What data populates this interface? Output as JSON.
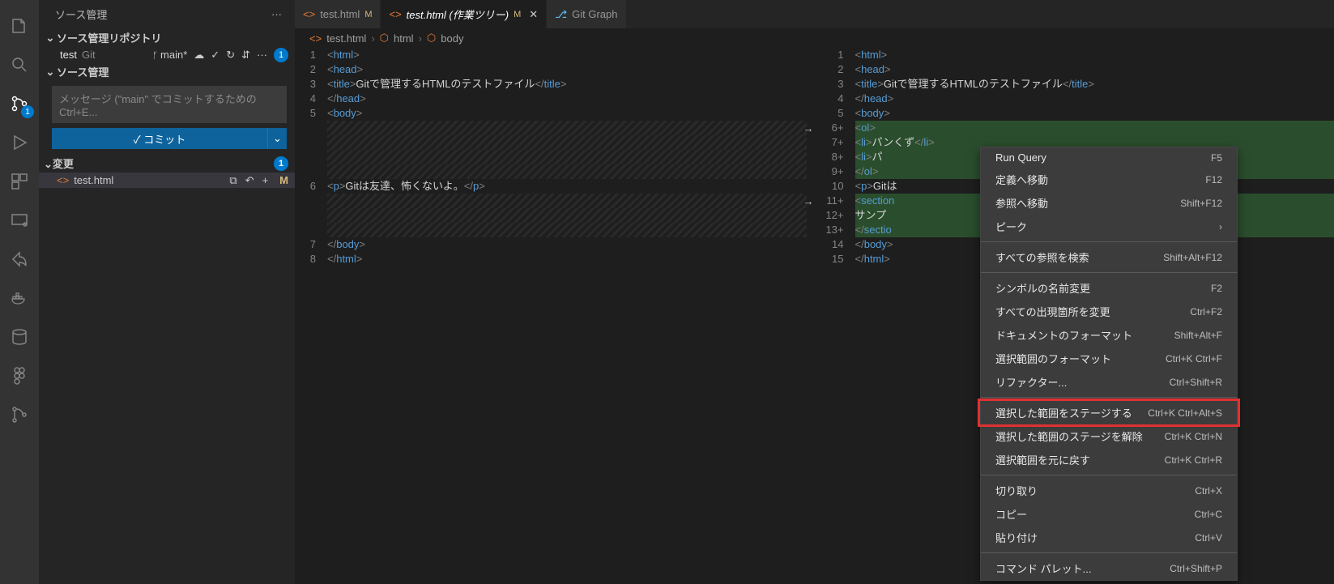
{
  "sidebar_title": "ソース管理",
  "sections": {
    "repo": "ソース管理リポジトリ",
    "scm": "ソース管理",
    "changes": "変更"
  },
  "repo": {
    "name": "test",
    "type": "Git",
    "branch": "main*",
    "badge": "1"
  },
  "commit": {
    "placeholder": "メッセージ (\"main\" でコミットするためのCtrl+E...",
    "button": "✓ コミット"
  },
  "changes_badge": "1",
  "file": {
    "name": "test.html",
    "status": "M"
  },
  "tabs": [
    {
      "icon": "<>",
      "label": "test.html",
      "mod": "M"
    },
    {
      "icon": "<>",
      "label": "test.html (作業ツリー)",
      "mod": "M",
      "active": true,
      "close": true,
      "italic": true
    },
    {
      "icon": "gg",
      "label": "Git Graph"
    }
  ],
  "breadcrumb": [
    "test.html",
    "html",
    "body"
  ],
  "left_lines": [
    {
      "n": "1",
      "html": "<span class='tag'>&lt;</span><span class='name'>html</span><span class='tag'>&gt;</span>"
    },
    {
      "n": "2",
      "html": "  <span class='tag'>&lt;</span><span class='name'>head</span><span class='tag'>&gt;</span>"
    },
    {
      "n": "3",
      "html": "    <span class='tag'>&lt;</span><span class='name'>title</span><span class='tag'>&gt;</span><span class='txt'>Gitで管理するHTMLのテストファイル</span><span class='tag'>&lt;/</span><span class='name'>title</span><span class='tag'>&gt;</span>"
    },
    {
      "n": "4",
      "html": "  <span class='tag'>&lt;/</span><span class='name'>head</span><span class='tag'>&gt;</span>"
    },
    {
      "n": "5",
      "html": "  <span class='tag'>&lt;</span><span class='name'>body</span><span class='tag'>&gt;</span>"
    },
    {
      "n": "",
      "html": "",
      "cls": "hatch"
    },
    {
      "n": "",
      "html": "",
      "cls": "hatch"
    },
    {
      "n": "",
      "html": "",
      "cls": "hatch"
    },
    {
      "n": "",
      "html": "",
      "cls": "hatch"
    },
    {
      "n": "6",
      "html": "    <span class='tag'>&lt;</span><span class='name'>p</span><span class='tag'>&gt;</span><span class='txt'>Gitは友達、怖くないよ。</span><span class='tag'>&lt;/</span><span class='name'>p</span><span class='tag'>&gt;</span>"
    },
    {
      "n": "",
      "html": "",
      "cls": "hatch"
    },
    {
      "n": "",
      "html": "",
      "cls": "hatch"
    },
    {
      "n": "",
      "html": "",
      "cls": "hatch"
    },
    {
      "n": "7",
      "html": "  <span class='tag'>&lt;/</span><span class='name'>body</span><span class='tag'>&gt;</span>"
    },
    {
      "n": "8",
      "html": "<span class='tag'>&lt;/</span><span class='name'>html</span><span class='tag'>&gt;</span>"
    }
  ],
  "right_lines": [
    {
      "n": "1",
      "html": "<span class='tag'>&lt;</span><span class='name'>html</span><span class='tag'>&gt;</span>"
    },
    {
      "n": "2",
      "html": "  <span class='tag'>&lt;</span><span class='name'>head</span><span class='tag'>&gt;</span>"
    },
    {
      "n": "3",
      "html": "    <span class='tag'>&lt;</span><span class='name'>title</span><span class='tag'>&gt;</span><span class='txt'>Gitで管理するHTMLのテストファイル</span><span class='tag'>&lt;/</span><span class='name'>title</span><span class='tag'>&gt;</span>"
    },
    {
      "n": "4",
      "html": "  <span class='tag'>&lt;/</span><span class='name'>head</span><span class='tag'>&gt;</span>"
    },
    {
      "n": "5",
      "html": "  <span class='tag'>&lt;</span><span class='name'>body</span><span class='tag'>&gt;</span>"
    },
    {
      "n": "6+",
      "html": "    <span class='tag'>&lt;</span><span class='name'>ol</span><span class='tag'>&gt;</span>",
      "cls": "added"
    },
    {
      "n": "7+",
      "html": "      <span class='tag'>&lt;</span><span class='name'>li</span><span class='tag'>&gt;</span><span class='txt'>パンくず</span><span class='tag'>&lt;/</span><span class='name'>li</span><span class='tag'>&gt;</span>",
      "cls": "added"
    },
    {
      "n": "8+",
      "html": "      <span class='tag'>&lt;</span><span class='name'>li</span><span class='tag'>&gt;</span><span class='txt'>パ</span>",
      "cls": "added"
    },
    {
      "n": "9+",
      "html": "    <span class='tag'>&lt;/</span><span class='name'>ol</span><span class='tag'>&gt;</span>",
      "cls": "added"
    },
    {
      "n": "10",
      "html": "    <span class='tag'>&lt;</span><span class='name'>p</span><span class='tag'>&gt;</span><span class='txt'>Gitは</span>"
    },
    {
      "n": "11+",
      "html": "    <span class='tag'>&lt;</span><span class='name'>section</span>",
      "cls": "added"
    },
    {
      "n": "12+",
      "html": "      <span class='txt'>サンプ</span>",
      "cls": "added"
    },
    {
      "n": "13+",
      "html": "    <span class='tag'>&lt;/</span><span class='name'>sectio</span>",
      "cls": "added"
    },
    {
      "n": "14",
      "html": "  <span class='tag'>&lt;/</span><span class='name'>body</span><span class='tag'>&gt;</span>"
    },
    {
      "n": "15",
      "html": "<span class='tag'>&lt;/</span><span class='name'>html</span><span class='tag'>&gt;</span>"
    }
  ],
  "menu": [
    {
      "label": "Run Query",
      "sc": "F5"
    },
    {
      "label": "定義へ移動",
      "sc": "F12"
    },
    {
      "label": "参照へ移動",
      "sc": "Shift+F12"
    },
    {
      "label": "ピーク",
      "sc": "›"
    },
    {
      "sep": true
    },
    {
      "label": "すべての参照を検索",
      "sc": "Shift+Alt+F12"
    },
    {
      "sep": true
    },
    {
      "label": "シンボルの名前変更",
      "sc": "F2"
    },
    {
      "label": "すべての出現箇所を変更",
      "sc": "Ctrl+F2"
    },
    {
      "label": "ドキュメントのフォーマット",
      "sc": "Shift+Alt+F"
    },
    {
      "label": "選択範囲のフォーマット",
      "sc": "Ctrl+K Ctrl+F"
    },
    {
      "label": "リファクター...",
      "sc": "Ctrl+Shift+R"
    },
    {
      "sep": true
    },
    {
      "label": "選択した範囲をステージする",
      "sc": "Ctrl+K Ctrl+Alt+S",
      "hl": true
    },
    {
      "label": "選択した範囲のステージを解除",
      "sc": "Ctrl+K Ctrl+N"
    },
    {
      "label": "選択範囲を元に戻す",
      "sc": "Ctrl+K Ctrl+R"
    },
    {
      "sep": true
    },
    {
      "label": "切り取り",
      "sc": "Ctrl+X"
    },
    {
      "label": "コピー",
      "sc": "Ctrl+C"
    },
    {
      "label": "貼り付け",
      "sc": "Ctrl+V"
    },
    {
      "sep": true
    },
    {
      "label": "コマンド パレット...",
      "sc": "Ctrl+Shift+P"
    }
  ]
}
